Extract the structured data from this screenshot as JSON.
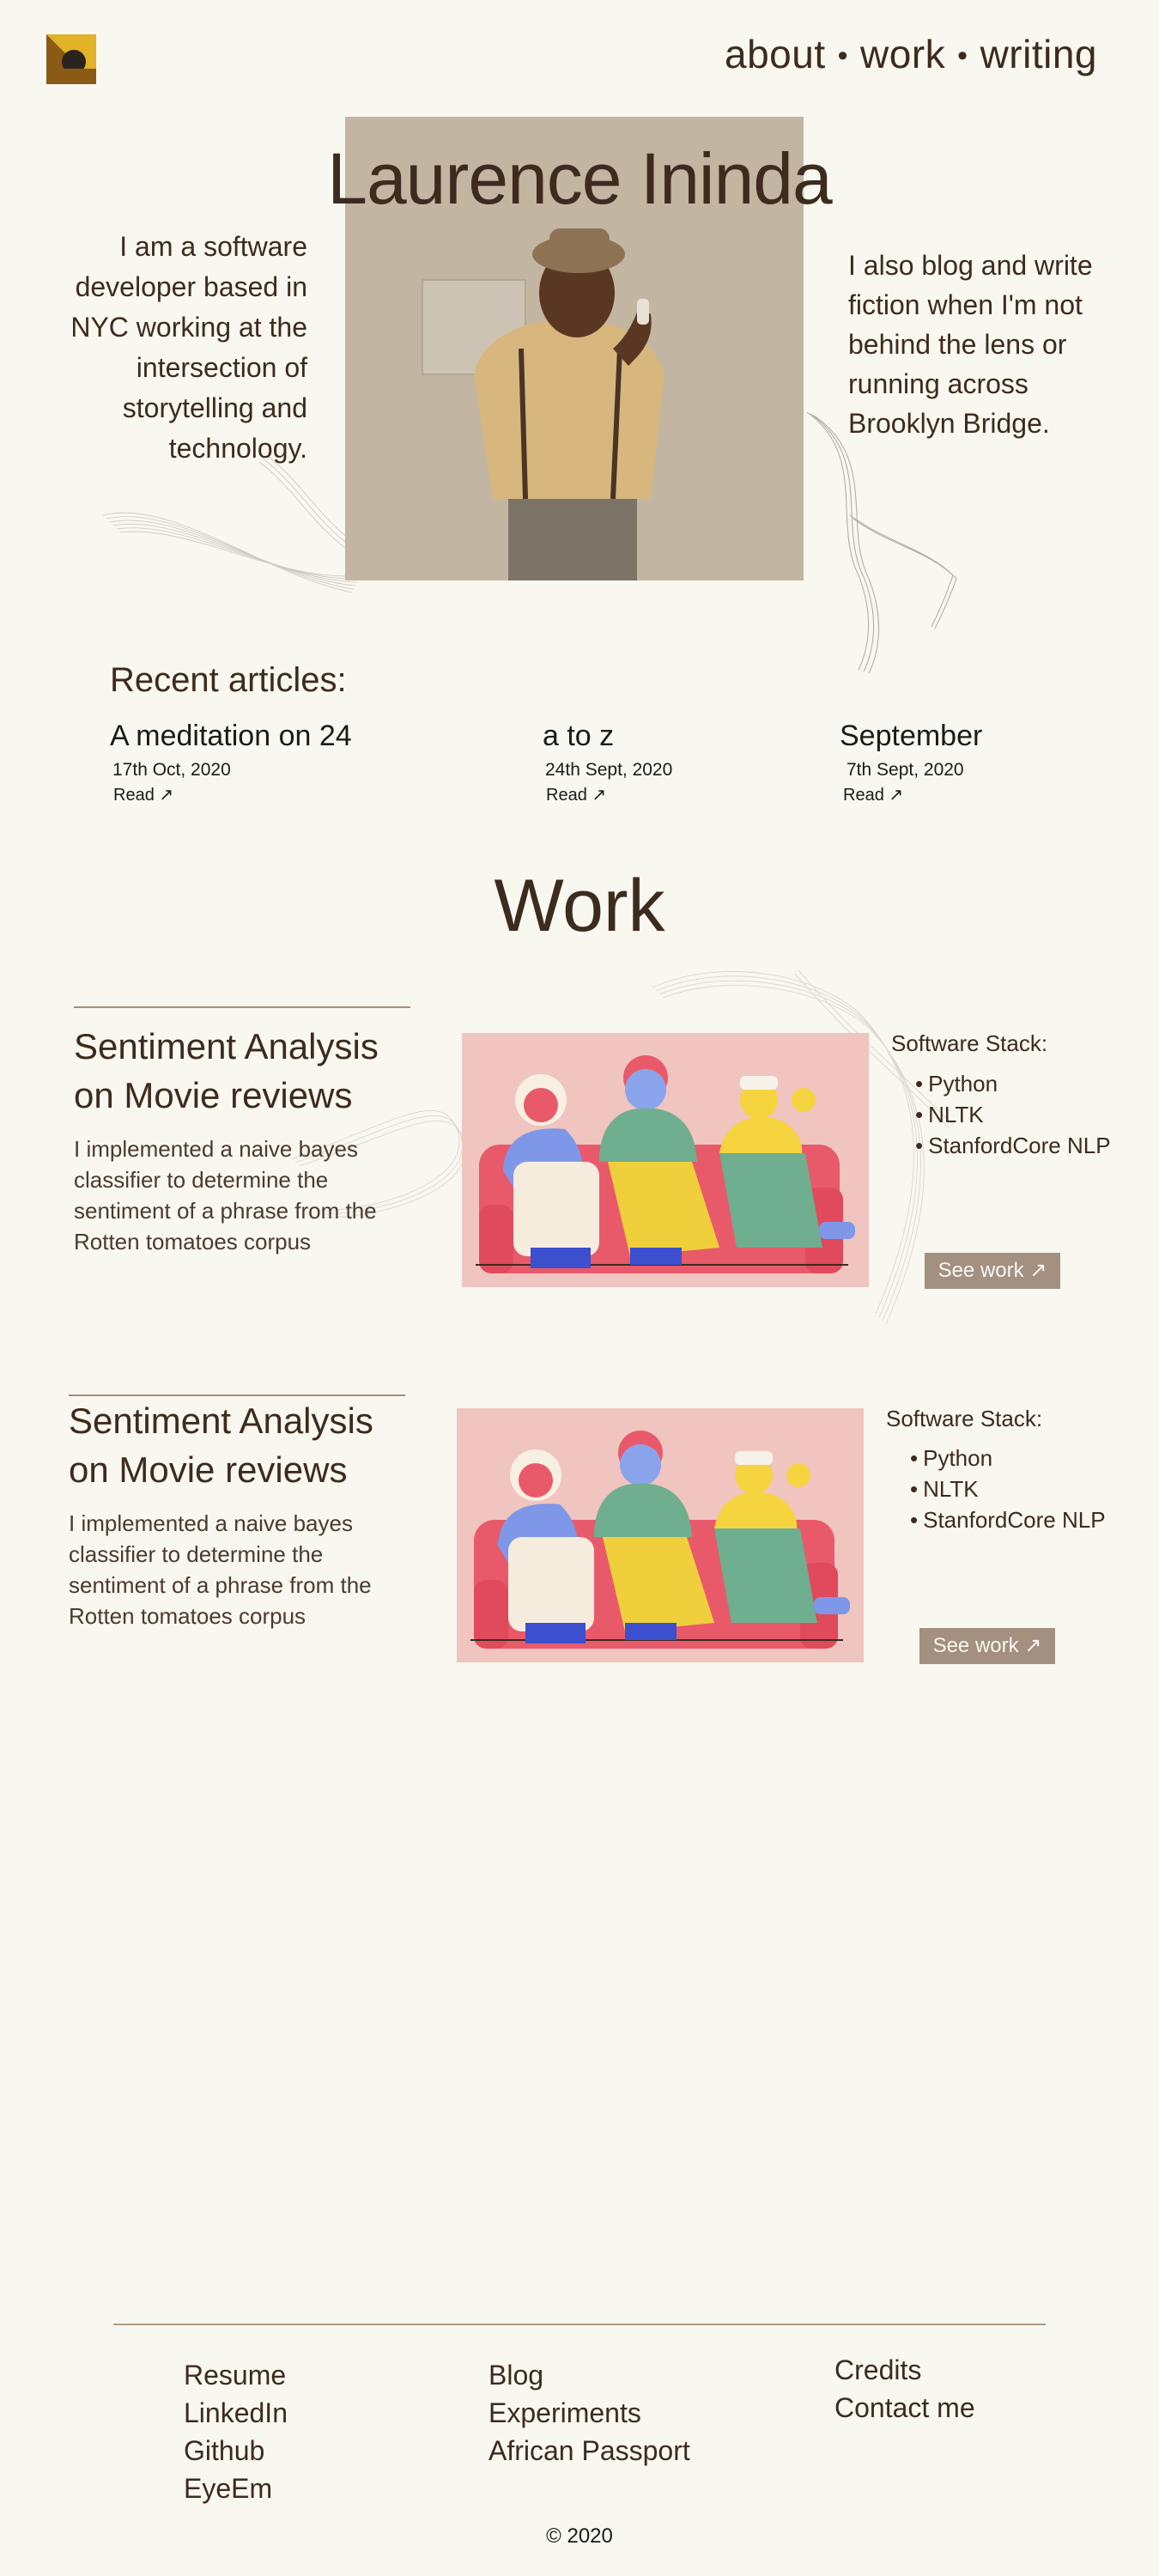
{
  "header": {
    "nav": [
      {
        "label": "about"
      },
      {
        "label": "work"
      },
      {
        "label": "writing"
      }
    ],
    "separator": "•"
  },
  "hero": {
    "name": "Laurence Ininda",
    "intro_left": "I am a software developer based in NYC working at the intersection of storytelling and technology.",
    "intro_right": "I also blog and write fiction when I'm not behind the lens or running across Brooklyn Bridge."
  },
  "articles": {
    "heading": "Recent articles:",
    "items": [
      {
        "title": "A meditation on 24",
        "date": "17th Oct, 2020",
        "read": "Read ↗"
      },
      {
        "title": "a to z",
        "date": "24th Sept, 2020",
        "read": "Read ↗"
      },
      {
        "title": "September",
        "date": "7th Sept, 2020",
        "read": "Read ↗"
      }
    ]
  },
  "work": {
    "heading": "Work",
    "projects": [
      {
        "title_line1": "Sentiment Analysis",
        "title_line2": "on Movie reviews",
        "description": "I implemented a naive bayes classifier to determine the sentiment of a phrase from the Rotten tomatoes corpus",
        "stack_title": "Software Stack:",
        "stack": [
          "Python",
          "NLTK",
          "StanfordCore NLP"
        ],
        "button": "See work ↗"
      },
      {
        "title_line1": "Sentiment Analysis",
        "title_line2": "on Movie reviews",
        "description": "I implemented a naive bayes classifier to determine the sentiment of a phrase from the Rotten tomatoes corpus",
        "stack_title": "Software Stack:",
        "stack": [
          "Python",
          "NLTK",
          "StanfordCore NLP"
        ],
        "button": "See work ↗"
      }
    ]
  },
  "footer": {
    "col1": [
      "Resume",
      "LinkedIn",
      "Github",
      "EyeEm"
    ],
    "col2": [
      "Blog",
      "Experiments",
      "African Passport"
    ],
    "col3": [
      "Credits",
      "Contact me"
    ],
    "copyright": "© 2020"
  },
  "colors": {
    "background": "#f8f7f0",
    "text": "#3d2b1f",
    "accent_gold": "#e2b227",
    "accent_brown": "#8a5a16",
    "button": "#a39080",
    "illustration_bg": "#f0c4bf"
  }
}
